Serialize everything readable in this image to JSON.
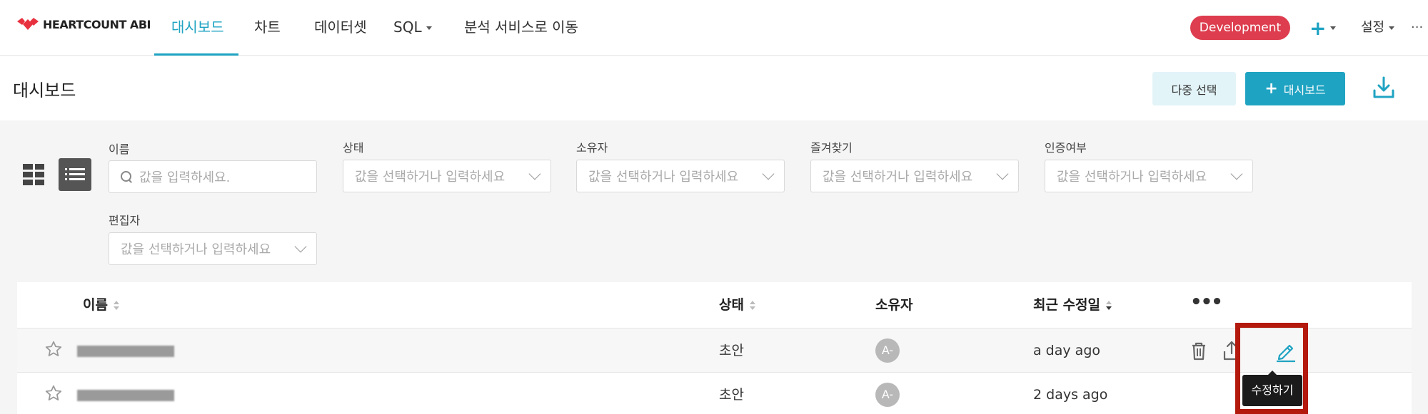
{
  "app": {
    "logo_text": "HEARTCOUNT ABI"
  },
  "nav": {
    "items": [
      {
        "label": "대시보드"
      },
      {
        "label": "차트"
      },
      {
        "label": "데이터셋"
      },
      {
        "label": "SQL"
      },
      {
        "label": "분석 서비스로 이동"
      }
    ],
    "active": "대시보드",
    "env_badge": "Development",
    "env_badge_color": "#dd3d4e",
    "settings_label": "설정",
    "accent_color": "#1fa3c2"
  },
  "header": {
    "title": "대시보드",
    "multi_select_label": "다중 선택",
    "add_dashboard_label": "대시보드"
  },
  "filters": {
    "name": {
      "label": "이름",
      "placeholder": "값을 입력하세요."
    },
    "status": {
      "label": "상태",
      "placeholder": "값을 선택하거나 입력하세요"
    },
    "owner": {
      "label": "소유자",
      "placeholder": "값을 선택하거나 입력하세요"
    },
    "favorites": {
      "label": "즐겨찾기",
      "placeholder": "값을 선택하거나 입력하세요"
    },
    "certified": {
      "label": "인증여부",
      "placeholder": "값을 선택하거나 입력하세요"
    },
    "editor": {
      "label": "편집자",
      "placeholder": "값을 선택하거나 입력하세요"
    }
  },
  "table": {
    "columns": {
      "name": "이름",
      "status": "상태",
      "owner": "소유자",
      "modified": "최근 수정일"
    },
    "rows": [
      {
        "status": "초안",
        "owner_initials": "A-",
        "modified": "a day ago"
      },
      {
        "status": "초안",
        "owner_initials": "A-",
        "modified": "2 days ago"
      }
    ]
  },
  "tooltip": {
    "edit": "수정하기"
  }
}
